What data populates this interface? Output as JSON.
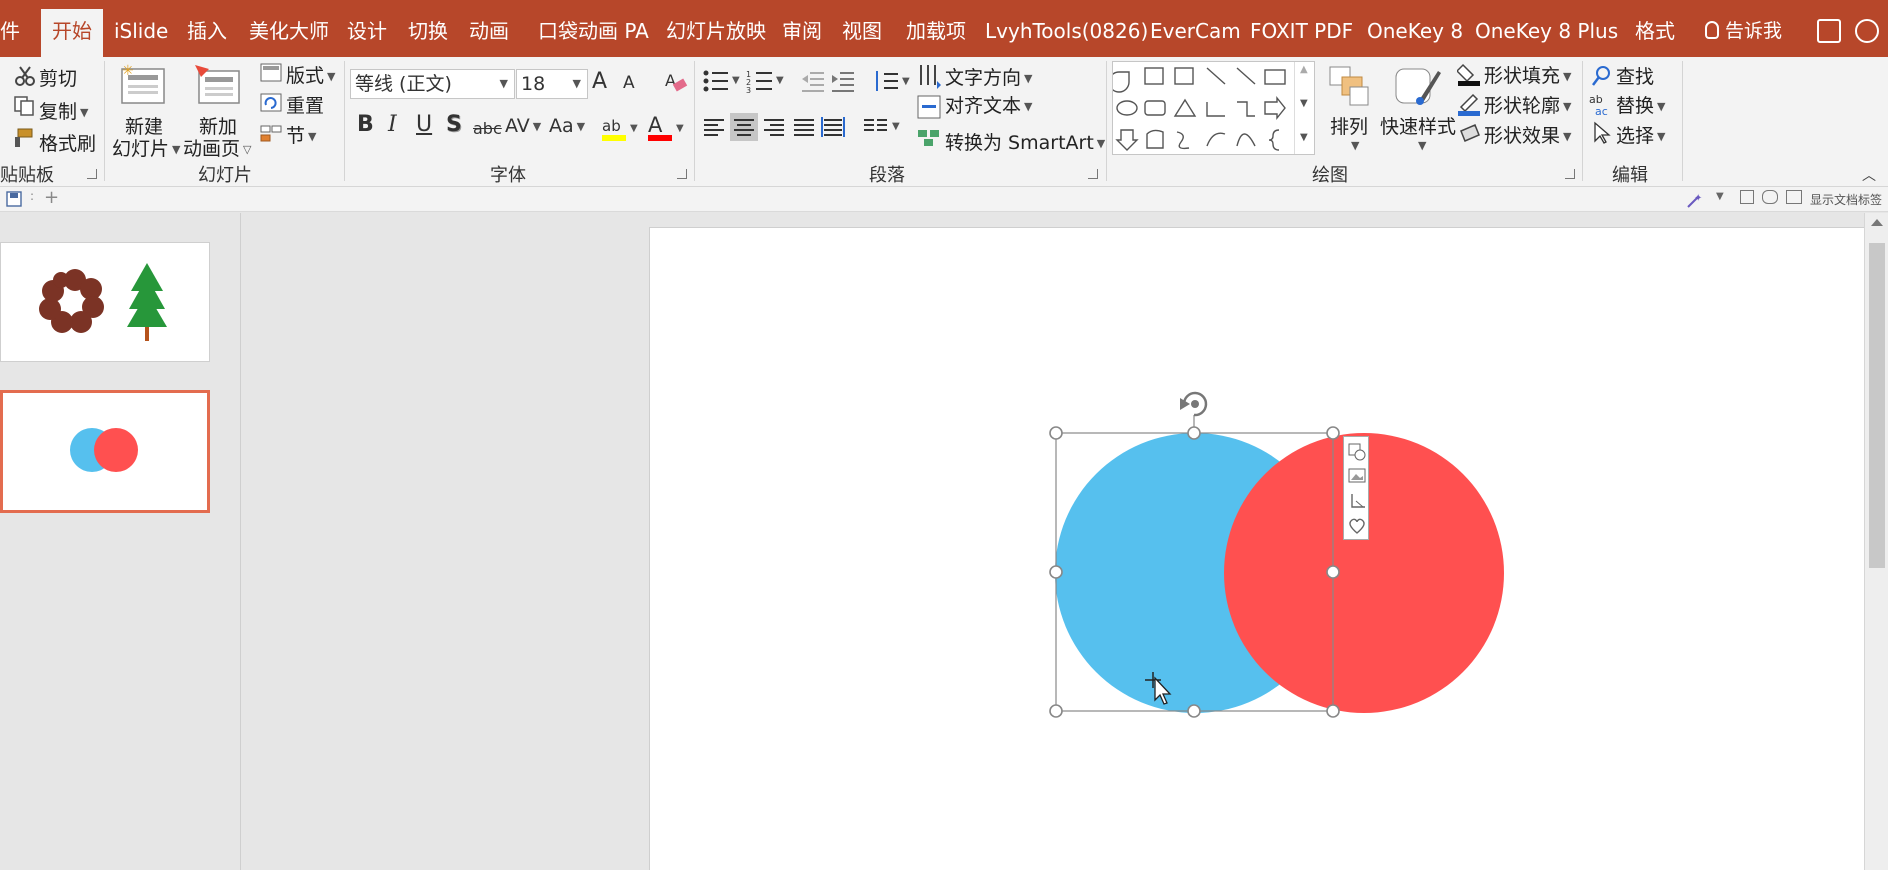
{
  "tabs": [
    {
      "label": "件",
      "active": false
    },
    {
      "label": "开始",
      "active": true
    },
    {
      "label": "iSlide",
      "active": false
    },
    {
      "label": "插入",
      "active": false
    },
    {
      "label": "美化大师",
      "active": false
    },
    {
      "label": "设计",
      "active": false
    },
    {
      "label": "切换",
      "active": false
    },
    {
      "label": "动画",
      "active": false
    },
    {
      "label": "口袋动画 PA",
      "active": false
    },
    {
      "label": "幻灯片放映",
      "active": false
    },
    {
      "label": "审阅",
      "active": false
    },
    {
      "label": "视图",
      "active": false
    },
    {
      "label": "加载项",
      "active": false
    },
    {
      "label": "LvyhTools(0826)",
      "active": false
    },
    {
      "label": "EverCam",
      "active": false
    },
    {
      "label": "FOXIT PDF",
      "active": false
    },
    {
      "label": "OneKey 8",
      "active": false
    },
    {
      "label": "OneKey 8 Plus",
      "active": false
    },
    {
      "label": "格式",
      "active": false
    }
  ],
  "tell_me": "告诉我",
  "ribbon": {
    "clipboard": {
      "cut": "剪切",
      "copy": "复制",
      "format_painter": "格式刷",
      "label": "贴贴板"
    },
    "slides": {
      "new_slide_1": "新建",
      "new_slide_2": "幻灯片",
      "new_anim_1": "新加",
      "new_anim_2": "动画页",
      "layout": "版式",
      "reset": "重置",
      "section": "节",
      "label": "幻灯片"
    },
    "font": {
      "font_name": "等线 (正文)",
      "font_size": "18",
      "bold": "B",
      "italic": "I",
      "underline": "U",
      "shadow": "S",
      "strike": "abc",
      "spacing": "AV",
      "case": "Aa",
      "color_letter": "A",
      "grow": "A",
      "shrink": "A",
      "label": "字体"
    },
    "paragraph": {
      "text_direction": "文字方向",
      "align_text": "对齐文本",
      "smartart": "转换为 SmartArt",
      "label": "段落"
    },
    "drawing": {
      "arrange": "排列",
      "quick_styles": "快速样式",
      "shape_fill": "形状填充",
      "shape_outline": "形状轮廓",
      "shape_effects": "形状效果",
      "label": "绘图"
    },
    "editing": {
      "find": "查找",
      "replace": "替换",
      "select": "选择",
      "label": "编辑"
    }
  },
  "qat": {
    "status_text": "显示文档标签"
  },
  "colors": {
    "brand": "#b7472a",
    "blue_circle": "#56c0ee",
    "red_circle": "#ff5050",
    "thumb_dot": "#7b3325",
    "tree": "#27973a",
    "selection_border": "#e36c4f"
  },
  "slide_content": {
    "shapes": [
      "blue-circle",
      "red-circle"
    ],
    "selected": "blue-circle"
  },
  "mini_toolbar_icons": [
    "shape-icon",
    "image-icon",
    "crop-icon",
    "heart-icon"
  ]
}
